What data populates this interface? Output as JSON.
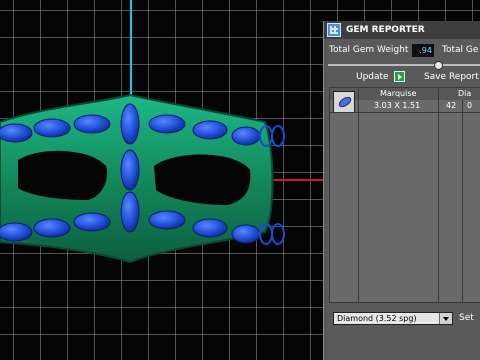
{
  "viewport": {
    "colors": {
      "background": "#050505",
      "grid": "#969696",
      "y_axis": "#19c6f0",
      "x_axis": "#d01818",
      "mask": "#17a070",
      "gems": "#1f4fd8"
    }
  },
  "panel": {
    "title": "GEM REPORTER",
    "total_gem_weight_label": "Total Gem Weight",
    "total_gem_weight_value": ".94",
    "total_gem_label_2": "Total Ge",
    "update_label": "Update",
    "save_report_label": "Save Report",
    "columns": [
      "Marquise",
      "Dia"
    ],
    "rows": [
      {
        "size": "3.03 X 1.51",
        "count": "42",
        "extra": "0"
      }
    ],
    "gem_type_selected": "Diamond     (3.52 spg)",
    "set_label": "Set"
  }
}
